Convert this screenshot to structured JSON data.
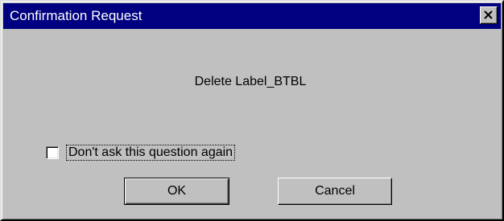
{
  "dialog": {
    "title": "Confirmation Request",
    "close_icon": "close-icon",
    "message": "Delete Label_BTBL",
    "checkbox": {
      "label": "Don't ask this question again",
      "checked": false
    },
    "buttons": {
      "ok_label": "OK",
      "cancel_label": "Cancel"
    }
  },
  "colors": {
    "titlebar": "#000080",
    "title_text": "#ffffff",
    "face": "#c0c0c0"
  }
}
